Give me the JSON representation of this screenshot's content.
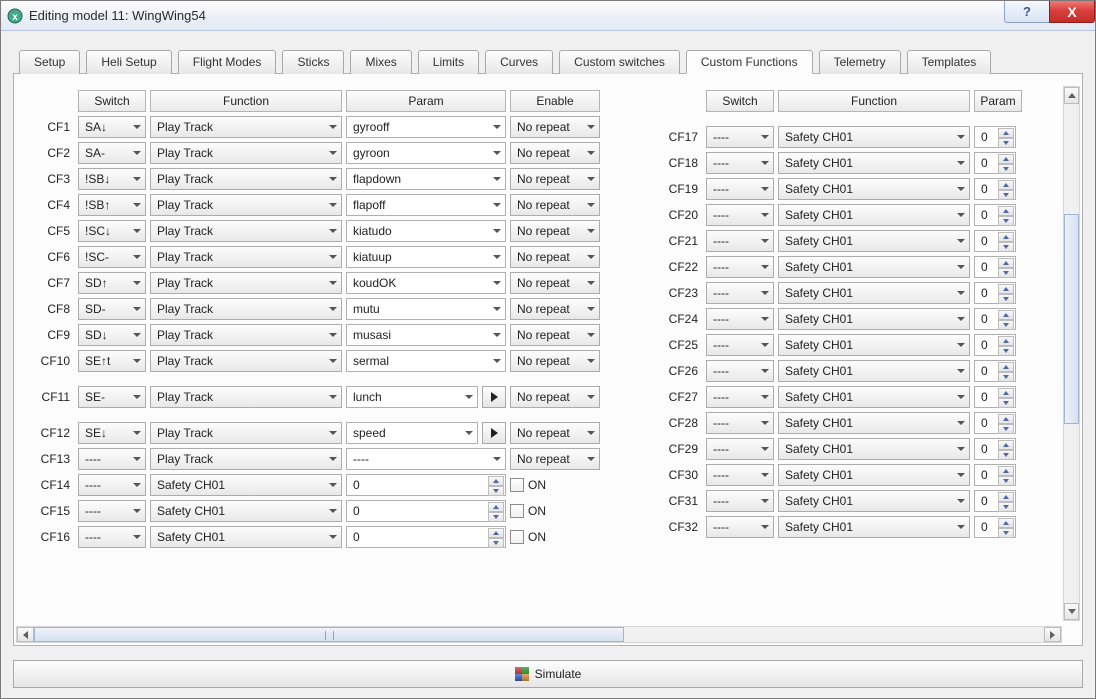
{
  "window": {
    "title": "Editing model 11: WingWing54"
  },
  "titlebar": {
    "help": "?",
    "close": "X"
  },
  "tabs": [
    "Setup",
    "Heli Setup",
    "Flight Modes",
    "Sticks",
    "Mixes",
    "Limits",
    "Curves",
    "Custom switches",
    "Custom Functions",
    "Telemetry",
    "Templates"
  ],
  "active_tab": "Custom Functions",
  "headers": {
    "switch": "Switch",
    "function": "Function",
    "param": "Param",
    "enable": "Enable"
  },
  "enable_norepeat": "No repeat",
  "on_label": "ON",
  "simulate": "Simulate",
  "left": [
    {
      "id": "CF1",
      "switch": "SA↓",
      "func": "Play Track",
      "param": "gyrooff",
      "type": "combo",
      "enable": "norepeat"
    },
    {
      "id": "CF2",
      "switch": "SA-",
      "func": "Play Track",
      "param": "gyroon",
      "type": "combo",
      "enable": "norepeat"
    },
    {
      "id": "CF3",
      "switch": "!SB↓",
      "func": "Play Track",
      "param": "flapdown",
      "type": "combo",
      "enable": "norepeat"
    },
    {
      "id": "CF4",
      "switch": "!SB↑",
      "func": "Play Track",
      "param": "flapoff",
      "type": "combo",
      "enable": "norepeat"
    },
    {
      "id": "CF5",
      "switch": "!SC↓",
      "func": "Play Track",
      "param": "kiatudo",
      "type": "combo",
      "enable": "norepeat"
    },
    {
      "id": "CF6",
      "switch": "!SC-",
      "func": "Play Track",
      "param": "kiatuup",
      "type": "combo",
      "enable": "norepeat"
    },
    {
      "id": "CF7",
      "switch": "SD↑",
      "func": "Play Track",
      "param": "koudOK",
      "type": "combo",
      "enable": "norepeat"
    },
    {
      "id": "CF8",
      "switch": "SD-",
      "func": "Play Track",
      "param": "mutu",
      "type": "combo",
      "enable": "norepeat"
    },
    {
      "id": "CF9",
      "switch": "SD↓",
      "func": "Play Track",
      "param": "musasi",
      "type": "combo",
      "enable": "norepeat"
    },
    {
      "id": "CF10",
      "switch": "SE↑t",
      "func": "Play Track",
      "param": "sermal",
      "type": "combo",
      "enable": "norepeat"
    },
    {
      "id": "CF11",
      "switch": "SE-",
      "func": "Play Track",
      "param": "lunch",
      "type": "combo_play",
      "enable": "norepeat",
      "gap": true
    },
    {
      "id": "CF12",
      "switch": "SE↓",
      "func": "Play Track",
      "param": "speed",
      "type": "combo_play",
      "enable": "norepeat",
      "gap": true
    },
    {
      "id": "CF13",
      "switch": "----",
      "func": "Play Track",
      "param": "----",
      "type": "combo",
      "enable": "norepeat"
    },
    {
      "id": "CF14",
      "switch": "----",
      "func": "Safety CH01",
      "param": "0",
      "type": "spin",
      "enable": "on"
    },
    {
      "id": "CF15",
      "switch": "----",
      "func": "Safety CH01",
      "param": "0",
      "type": "spin",
      "enable": "on"
    },
    {
      "id": "CF16",
      "switch": "----",
      "func": "Safety CH01",
      "param": "0",
      "type": "spin",
      "enable": "on"
    }
  ],
  "right": [
    {
      "id": "CF17",
      "switch": "----",
      "func": "Safety CH01",
      "param": "0"
    },
    {
      "id": "CF18",
      "switch": "----",
      "func": "Safety CH01",
      "param": "0"
    },
    {
      "id": "CF19",
      "switch": "----",
      "func": "Safety CH01",
      "param": "0"
    },
    {
      "id": "CF20",
      "switch": "----",
      "func": "Safety CH01",
      "param": "0"
    },
    {
      "id": "CF21",
      "switch": "----",
      "func": "Safety CH01",
      "param": "0"
    },
    {
      "id": "CF22",
      "switch": "----",
      "func": "Safety CH01",
      "param": "0"
    },
    {
      "id": "CF23",
      "switch": "----",
      "func": "Safety CH01",
      "param": "0"
    },
    {
      "id": "CF24",
      "switch": "----",
      "func": "Safety CH01",
      "param": "0"
    },
    {
      "id": "CF25",
      "switch": "----",
      "func": "Safety CH01",
      "param": "0"
    },
    {
      "id": "CF26",
      "switch": "----",
      "func": "Safety CH01",
      "param": "0"
    },
    {
      "id": "CF27",
      "switch": "----",
      "func": "Safety CH01",
      "param": "0"
    },
    {
      "id": "CF28",
      "switch": "----",
      "func": "Safety CH01",
      "param": "0"
    },
    {
      "id": "CF29",
      "switch": "----",
      "func": "Safety CH01",
      "param": "0"
    },
    {
      "id": "CF30",
      "switch": "----",
      "func": "Safety CH01",
      "param": "0"
    },
    {
      "id": "CF31",
      "switch": "----",
      "func": "Safety CH01",
      "param": "0"
    },
    {
      "id": "CF32",
      "switch": "----",
      "func": "Safety CH01",
      "param": "0"
    }
  ]
}
